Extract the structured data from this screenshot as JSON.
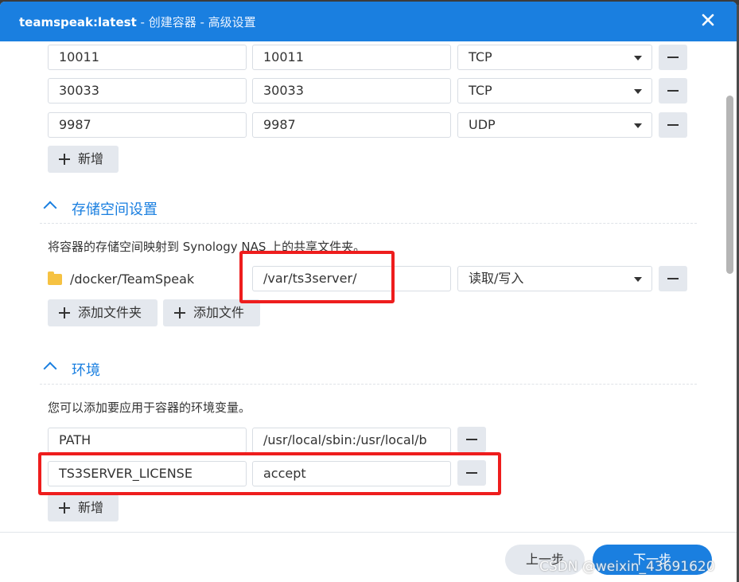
{
  "window": {
    "title_app": "teamspeak:latest",
    "title_rest": " - 创建容器 - 高级设置"
  },
  "ports": [
    {
      "local": "10011",
      "container": "10011",
      "type": "TCP"
    },
    {
      "local": "30033",
      "container": "30033",
      "type": "TCP"
    },
    {
      "local": "9987",
      "container": "9987",
      "type": "UDP"
    }
  ],
  "port_add_label": "新增",
  "storage": {
    "header": "存储空间设置",
    "description": "将容器的存储空间映射到 Synology NAS 上的共享文件夹。",
    "rows": [
      {
        "path": "/docker/TeamSpeak",
        "mount": "/var/ts3server/",
        "mode": "读取/写入"
      }
    ],
    "add_folder_label": "添加文件夹",
    "add_file_label": "添加文件"
  },
  "environment": {
    "header": "环境",
    "description": "您可以添加要应用于容器的环境变量。",
    "rows": [
      {
        "name": "PATH",
        "value": "/usr/local/sbin:/usr/local/b"
      },
      {
        "name": "TS3SERVER_LICENSE",
        "value": "accept"
      }
    ],
    "add_label": "新增"
  },
  "footer": {
    "prev_label": "上一步",
    "next_label": "下一步"
  },
  "watermark": "CSDN @weixin_43691620",
  "colors": {
    "accent": "#1a7fe0",
    "highlight": "#ee1d1d"
  }
}
